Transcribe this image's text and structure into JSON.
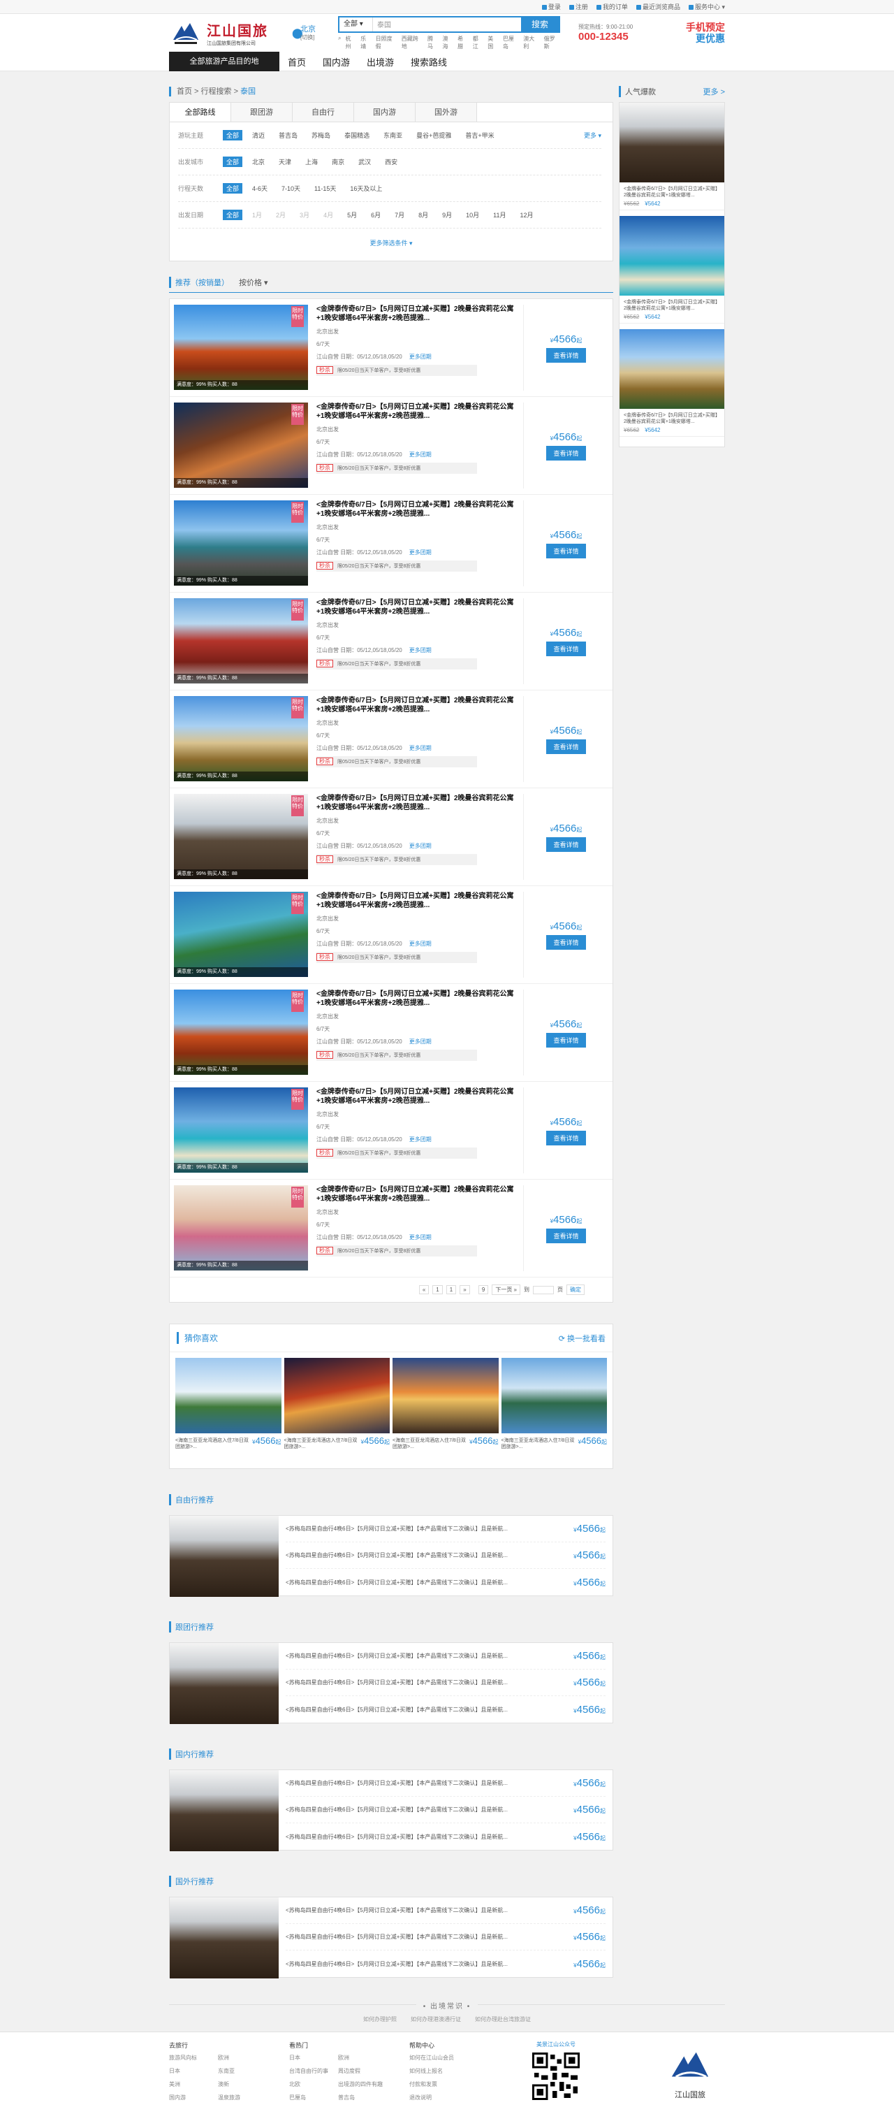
{
  "topbar": {
    "login": "登录",
    "register": "注册",
    "orders": "我的订单",
    "recent": "最近浏览商品",
    "service": "服务中心"
  },
  "header": {
    "brand": "江山国旅",
    "brand_sub": "江山国旅集团有限公司",
    "city": "北京",
    "city_switch": "[切换]",
    "search_type": "全部",
    "search_value": "泰国",
    "search_button": "搜索",
    "hot_words": [
      "杭州",
      "乐靖",
      "日照度假",
      "西藏跨地",
      "腾马",
      "澳海",
      "希腊",
      "都江",
      "美国",
      "巴厘岛",
      "澳大利",
      "俄罗斯"
    ],
    "hotline_label": "预定热线：9:00-21:00",
    "hotline_number": "000-12345",
    "promo_1": "手机预定",
    "promo_2": "更优惠"
  },
  "nav": {
    "all": "全部旅游产品目的地",
    "items": [
      "首页",
      "国内游",
      "出境游",
      "搜索路线"
    ]
  },
  "crumb": {
    "home": "首页",
    "sep1": " > ",
    "search": "行程搜索",
    "sep2": " > ",
    "current": "泰国"
  },
  "filter": {
    "tabs": [
      "全部路线",
      "跟团游",
      "自由行",
      "国内游",
      "国外游"
    ],
    "rows": [
      {
        "label": "游玩主题",
        "tag": "全部",
        "options": [
          "清迈",
          "普吉岛",
          "苏梅岛",
          "泰国精选",
          "东南亚",
          "曼谷+芭提雅",
          "普吉+甲米"
        ],
        "more": "更多 ▾"
      },
      {
        "label": "出发城市",
        "tag": "全部",
        "options": [
          "北京",
          "天津",
          "上海",
          "南京",
          "武汉",
          "西安"
        ],
        "more": ""
      },
      {
        "label": "行程天数",
        "tag": "全部",
        "options": [
          "4-6天",
          "7-10天",
          "11-15天",
          "16天及以上"
        ],
        "more": ""
      },
      {
        "label": "出发日期",
        "tag": "全部",
        "options": [
          "1月",
          "2月",
          "3月",
          "4月",
          "5月",
          "6月",
          "7月",
          "8月",
          "9月",
          "10月",
          "11月",
          "12月"
        ],
        "more": ""
      }
    ],
    "more_conditions": "更多筛选条件 ▾"
  },
  "sort": {
    "by_sales": "推荐（按销量）",
    "by_price": "按价格 ▾"
  },
  "product": {
    "title": "<金牌泰传奇6/7日>【5月网订日立减+买赠】2晚曼谷宾莉花公寓+1晚安娜塔64平米套房+2晚芭提雅...",
    "from": "北京出发",
    "days": "6/7天",
    "operator": "江山自营",
    "dates": "日期：05/12,05/18,05/20",
    "more_dates": "更多团期",
    "flash_tag": "秒杀",
    "flash_text": "限05/20日当天下单客户，享受8折优惠",
    "price": "4566",
    "price_unit": "起",
    "button": "查看详情",
    "ribbon": "限时特价",
    "bar": "满意度：99%    购买人数：88"
  },
  "pager": {
    "prev": "«",
    "p1": "1",
    "p2": "1",
    "next": "»",
    "p9": "9",
    "nextpage": "下一页 »",
    "to": "到",
    "page": "页",
    "go": "确定"
  },
  "guess": {
    "title": "猜你喜欢",
    "refresh": "换一批看看",
    "items": [
      {
        "desc": "<海南三亚亚龙湾酒店入住7/8日双团旅游>...",
        "price": "4566"
      },
      {
        "desc": "<海南三亚亚龙湾酒店入住7/8日双团旅游>...",
        "price": "4566"
      },
      {
        "desc": "<海南三亚亚龙湾酒店入住7/8日双团旅游>...",
        "price": "4566"
      },
      {
        "desc": "<海南三亚亚龙湾酒店入住7/8日双团旅游>...",
        "price": "4566"
      }
    ],
    "unit": "起"
  },
  "recs": {
    "sections": [
      "自由行推荐",
      "跟团行推荐",
      "国内行推荐",
      "国外行推荐"
    ],
    "line": "<苏梅岛四星自由行4晚6日>【5月网订日立减+买赠】【本产品需线下二次确认】且是新航...",
    "price": "4566",
    "unit": "起"
  },
  "sidebar": {
    "title": "人气爆款",
    "more": "更多 >",
    "items": [
      {
        "desc": "<金牌泰传奇6/7日>【5月网订日立减+买赠】2晚曼谷宾莉花公寓+1晚安娜塔...",
        "old": "¥6562",
        "new": "¥5642"
      },
      {
        "desc": "<金牌泰传奇6/7日>【5月网订日立减+买赠】2晚曼谷宾莉花公寓+1晚安娜塔...",
        "old": "¥6562",
        "new": "¥5642"
      },
      {
        "desc": "<金牌泰传奇6/7日>【5月网订日立减+买赠】2晚曼谷宾莉花公寓+1晚安娜塔...",
        "old": "¥6562",
        "new": "¥5642"
      }
    ]
  },
  "footer": {
    "nav_title": "• 出境常识 •",
    "nav_links": [
      "如何办理护照",
      "如何办理港澳通行证",
      "如何办理赴台湾旅游证"
    ],
    "col1_title": "去旅行",
    "col1": [
      "旅游风向标",
      "欧洲",
      "日本",
      "东南亚",
      "美洲",
      "澳新",
      "国内游",
      "温泉旅游"
    ],
    "col2_title": "看热门",
    "col2": [
      "日本",
      "欧洲",
      "台湾自由行的事",
      "周边度假",
      "北欧",
      "出境游的四件有趣",
      "巴厘岛",
      "普吉岛"
    ],
    "col3_title": "帮助中心",
    "col3": [
      "如何在江山山会员",
      "如何线上报名",
      "付款和发票",
      "退改说明"
    ],
    "qr_title": "美景江山公众号",
    "logo_text": "江山国旅"
  },
  "colors": {
    "accent": "#2a8dd4",
    "red": "#e4393c"
  }
}
